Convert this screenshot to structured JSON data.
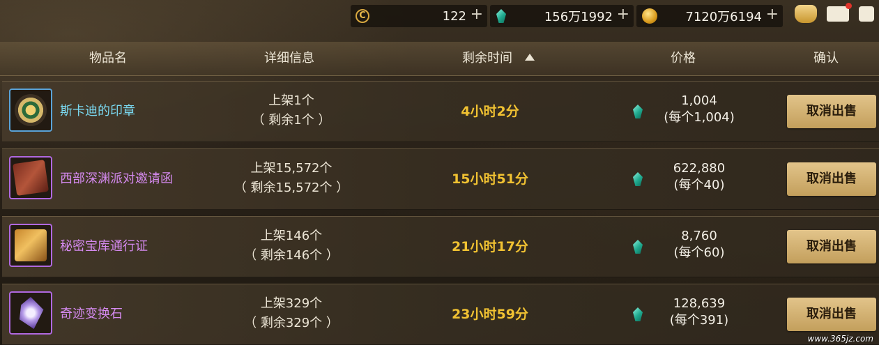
{
  "currency": {
    "cera_points": "122",
    "gems": "156万1992",
    "gold": "7120万6194",
    "plus_symbol": "+"
  },
  "header": {
    "item_name": "物品名",
    "details": "详细信息",
    "time_left": "剩余时间",
    "price": "价格",
    "confirm": "确认"
  },
  "rows": [
    {
      "name": "斯卡迪的印章",
      "listed": "上架1个",
      "remaining": "（ 剩余1个 ）",
      "time": "4小时2分",
      "total": "1,004",
      "unit": "(每个1,004)",
      "button": "取消出售"
    },
    {
      "name": "西部深渊派对邀请函",
      "listed": "上架15,572个",
      "remaining": "（ 剩余15,572个 ）",
      "time": "15小时51分",
      "total": "622,880",
      "unit": "(每个40)",
      "button": "取消出售"
    },
    {
      "name": "秘密宝库通行证",
      "listed": "上架146个",
      "remaining": "（ 剩余146个 ）",
      "time": "21小时17分",
      "total": "8,760",
      "unit": "(每个60)",
      "button": "取消出售"
    },
    {
      "name": "奇迹变换石",
      "listed": "上架329个",
      "remaining": "（ 剩余329个 ）",
      "time": "23小时59分",
      "total": "128,639",
      "unit": "(每个391)",
      "button": "取消出售"
    }
  ],
  "watermark": "www.365jz.com"
}
